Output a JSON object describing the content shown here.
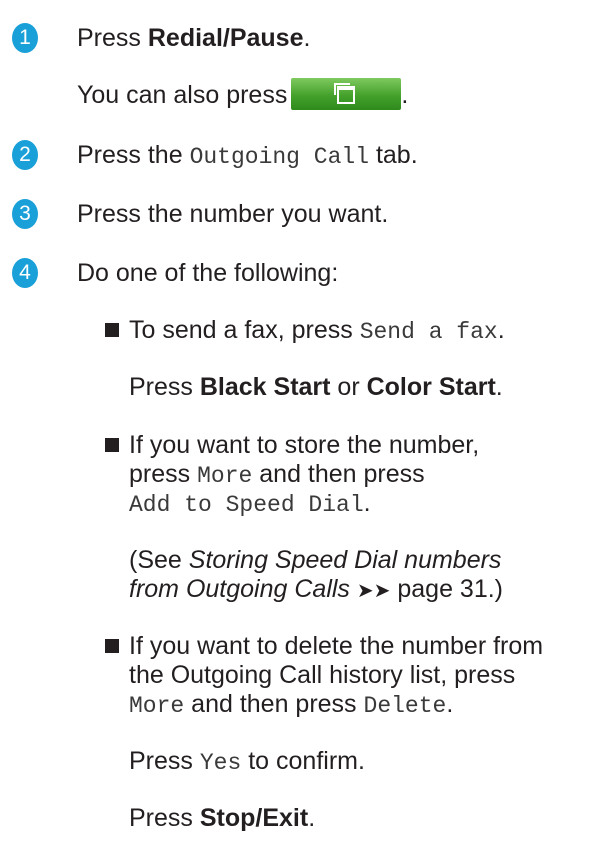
{
  "steps": [
    {
      "number": "1",
      "lines": [
        {
          "pre": "Press ",
          "bold": "Redial/Pause",
          "post": "."
        },
        {
          "pre": "You can also press",
          "post": "."
        }
      ]
    },
    {
      "number": "2",
      "line": {
        "pre": "Press the ",
        "mono": "Outgoing Call",
        "post": " tab."
      }
    },
    {
      "number": "3",
      "line": {
        "text": "Press the number you want."
      }
    },
    {
      "number": "4",
      "line": {
        "text": "Do one of the following:"
      },
      "bullets": [
        {
          "line1": {
            "pre": "To send a fax, press ",
            "mono": "Send a fax",
            "post": "."
          },
          "line2": {
            "pre": "Press ",
            "bold1": "Black Start",
            "mid": " or ",
            "bold2": "Color Start",
            "post": "."
          }
        },
        {
          "line1": {
            "text": "If you want to store the number,"
          },
          "line2": {
            "pre": "press ",
            "mono": "More",
            "post": " and then press"
          },
          "line3": {
            "mono": "Add to Speed Dial",
            "post": "."
          },
          "line4": {
            "pre": "(See ",
            "italic": "Storing Speed Dial numbers"
          },
          "line5": {
            "italic": "from Outgoing Calls",
            "arrows": "➤➤",
            "post": " page 31.)"
          }
        },
        {
          "line1": {
            "text": "If you want to delete the number from"
          },
          "line2": {
            "text": "the Outgoing Call history list, press"
          },
          "line3": {
            "mono1": "More",
            "mid": " and then press ",
            "mono2": "Delete",
            "post": "."
          },
          "line4": {
            "pre": "Press ",
            "mono": "Yes",
            "post": " to confirm."
          },
          "line5": {
            "pre": "Press ",
            "bold": "Stop/Exit",
            "post": "."
          }
        }
      ]
    }
  ],
  "icons": {
    "step_badge_color": "#1aa0d8",
    "inline_button": "window-stack-icon",
    "inline_button_color": "#44a12b"
  }
}
